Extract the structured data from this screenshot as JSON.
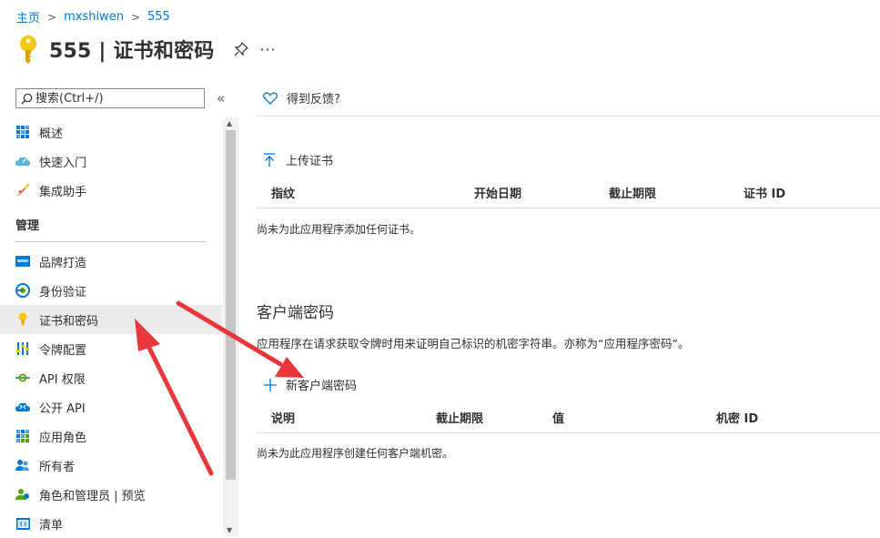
{
  "breadcrumb": [
    "主页",
    "mxshiwen",
    "555"
  ],
  "page": {
    "title": "555 | 证书和密码",
    "more": "···"
  },
  "search": {
    "placeholder": "搜索(Ctrl+/)",
    "collapse": "«"
  },
  "sidebar": {
    "top_items": [
      {
        "label": "概述",
        "icon": "grid-icon"
      },
      {
        "label": "快速入门",
        "icon": "cloud-rocket-icon"
      },
      {
        "label": "集成助手",
        "icon": "rocket-icon"
      }
    ],
    "section_label": "管理",
    "manage_items": [
      {
        "label": "品牌打造",
        "icon": "branding-icon"
      },
      {
        "label": "身份验证",
        "icon": "authentication-icon"
      },
      {
        "label": "证书和密码",
        "icon": "key-icon",
        "active": true
      },
      {
        "label": "令牌配置",
        "icon": "token-config-icon"
      },
      {
        "label": "API 权限",
        "icon": "api-permissions-icon"
      },
      {
        "label": "公开 API",
        "icon": "cloud-api-icon"
      },
      {
        "label": "应用角色",
        "icon": "app-roles-icon"
      },
      {
        "label": "所有者",
        "icon": "owners-icon"
      },
      {
        "label": "角色和管理员 | 预览",
        "icon": "roles-admins-icon"
      },
      {
        "label": "清单",
        "icon": "manifest-icon"
      }
    ]
  },
  "toolbar": {
    "feedback_label": "得到反馈?"
  },
  "certificates": {
    "upload_label": "上传证书",
    "columns": [
      "指纹",
      "开始日期",
      "截止期限",
      "证书 ID"
    ],
    "empty_text": "尚未为此应用程序添加任何证书。"
  },
  "secrets": {
    "title": "客户端密码",
    "description": "应用程序在请求获取令牌时用来证明自己标识的机密字符串。亦称为“应用程序密码”。",
    "new_label": "新客户端密码",
    "columns": [
      "说明",
      "截止期限",
      "值",
      "机密 ID"
    ],
    "empty_text": "尚未为此应用程序创建任何客户端机密。"
  },
  "colors": {
    "link": "#0078d4",
    "key_yellow": "#f2c811",
    "arrow_red": "#e8383d",
    "active_bg": "#edebe9"
  }
}
